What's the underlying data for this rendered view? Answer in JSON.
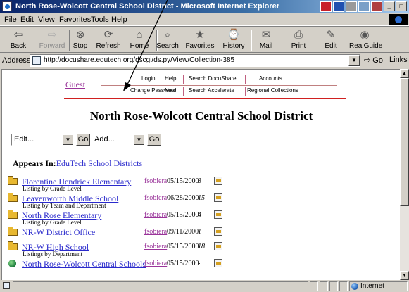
{
  "window": {
    "title": "North Rose-Wolcott Central School District - Microsoft Internet Explorer",
    "controls": [
      "_",
      "□",
      "×"
    ]
  },
  "menu": [
    "File",
    "Edit",
    "View",
    "Favorites",
    "Tools",
    "Help"
  ],
  "toolbar": [
    {
      "label": "Back",
      "icon": "back-arrow-icon",
      "glyph": "⇦",
      "disabled": false
    },
    {
      "label": "Forward",
      "icon": "forward-arrow-icon",
      "glyph": "⇨",
      "disabled": true
    },
    {
      "label": "Stop",
      "icon": "stop-icon",
      "glyph": "⊗",
      "disabled": false
    },
    {
      "label": "Refresh",
      "icon": "refresh-icon",
      "glyph": "⟳",
      "disabled": false
    },
    {
      "label": "Home",
      "icon": "home-icon",
      "glyph": "⌂",
      "disabled": false
    },
    {
      "label": "Search",
      "icon": "search-icon",
      "glyph": "⌕",
      "disabled": false
    },
    {
      "label": "Favorites",
      "icon": "favorites-icon",
      "glyph": "★",
      "disabled": false
    },
    {
      "label": "History",
      "icon": "history-icon",
      "glyph": "⌚",
      "disabled": false
    },
    {
      "label": "Mail",
      "icon": "mail-icon",
      "glyph": "✉",
      "disabled": false
    },
    {
      "label": "Print",
      "icon": "print-icon",
      "glyph": "⎙",
      "disabled": false
    },
    {
      "label": "Edit",
      "icon": "edit-icon",
      "glyph": "✎",
      "disabled": false
    },
    {
      "label": "RealGuide",
      "icon": "realguide-icon",
      "glyph": "◉",
      "disabled": false
    }
  ],
  "address": {
    "label": "Address",
    "url": "http://docushare.edutech.org/dscgi/ds.py/View/Collection-385",
    "go_label": "Go",
    "links_label": "Links »"
  },
  "page": {
    "guest_link": "Guest",
    "nav": {
      "login": "Login",
      "change_password": "Change Password",
      "help": "Help",
      "new": "New",
      "search_docushare": "Search DocuShare",
      "search_accelerate": "Search Accelerate",
      "accounts": "Accounts",
      "regional_collections": "Regional Collections"
    },
    "heading": "North Rose-Wolcott Central School District",
    "actions": {
      "edit_select": "Edit...",
      "add_select": "Add...",
      "go_label": "Go"
    },
    "appears_in": {
      "label": "Appears In:",
      "link": "EduTech School Districts"
    },
    "items": [
      {
        "name": "Florentine Hendrick Elementary",
        "desc": "Listing by Grade Level",
        "owner": "fsobiera",
        "date": "05/15/2000",
        "count": "3",
        "kind": "folder"
      },
      {
        "name": "Leavenworth Middle School",
        "desc": "Listing by Team and Department",
        "owner": "fsobiera",
        "date": "06/28/2000",
        "count": "15",
        "kind": "folder"
      },
      {
        "name": "North Rose Elementary",
        "desc": "Listing by Grade Level",
        "owner": "fsobiera",
        "date": "05/15/2000",
        "count": "4",
        "kind": "folder"
      },
      {
        "name": "NR-W District Office",
        "desc": "",
        "owner": "fsobiera",
        "date": "09/11/2000",
        "count": "1",
        "kind": "folder"
      },
      {
        "name": "NR-W High School",
        "desc": "Listings by Department",
        "owner": "fsobiera",
        "date": "05/15/2000",
        "count": "18",
        "kind": "folder"
      },
      {
        "name": "North Rose-Wolcott Central Schools",
        "desc": "",
        "owner": "fsobiera",
        "date": "05/15/2000",
        "count": "-",
        "kind": "url"
      }
    ]
  },
  "status": {
    "zone": "Internet"
  },
  "colors": {
    "link": "#2a2acc",
    "visited": "#9a349a",
    "rule": "#d02020",
    "titlebar_start": "#0a246a",
    "titlebar_end": "#a6caf0"
  }
}
